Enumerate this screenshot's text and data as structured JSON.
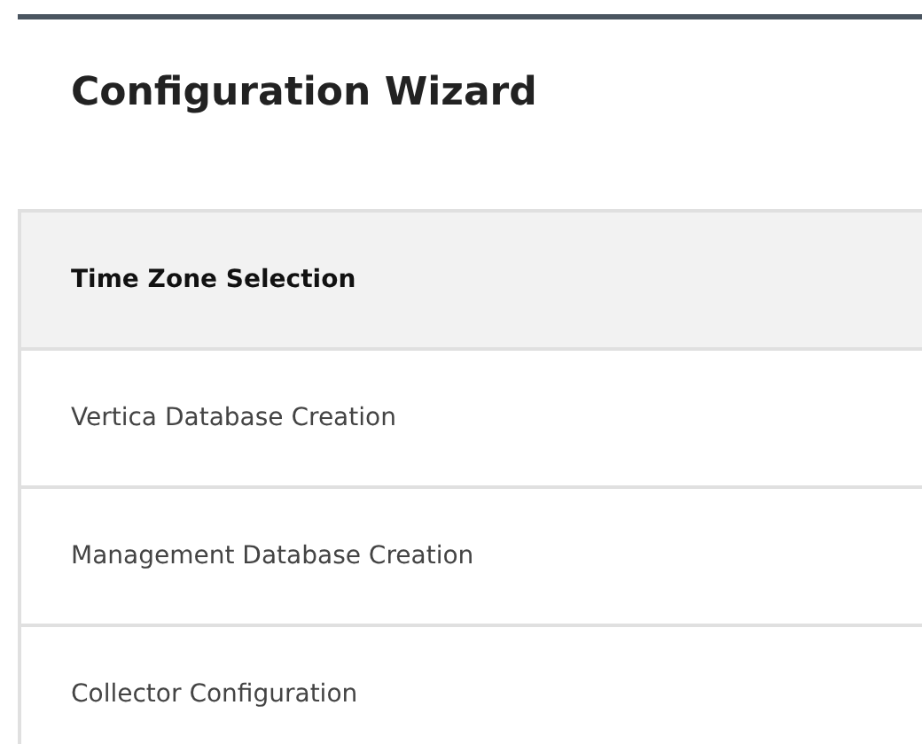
{
  "title": "Configuration Wizard",
  "steps": [
    {
      "label": "Time Zone Selection",
      "selected": true
    },
    {
      "label": "Vertica Database Creation",
      "selected": false
    },
    {
      "label": "Management Database Creation",
      "selected": false
    },
    {
      "label": "Collector Configuration",
      "selected": false
    }
  ]
}
